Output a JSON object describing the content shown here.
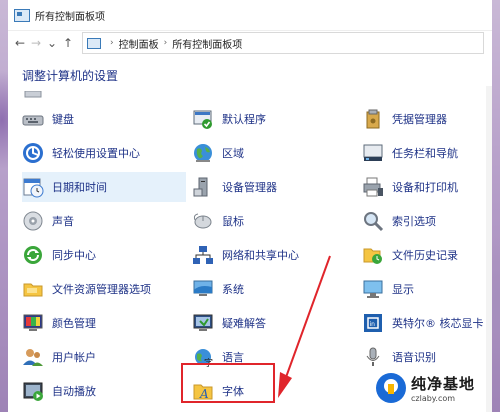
{
  "window": {
    "title": "所有控制面板项"
  },
  "nav": {
    "back": "←",
    "forward": "→",
    "recent": "⌄",
    "up": "↑",
    "breadcrumb": [
      "控制面板",
      "所有控制面板项"
    ],
    "separator": "›"
  },
  "heading": "调整计算机的设置",
  "items": [
    {
      "label": "键盘",
      "icon": "keyboard-icon"
    },
    {
      "label": "默认程序",
      "icon": "default-programs-icon"
    },
    {
      "label": "凭据管理器",
      "icon": "credential-manager-icon"
    },
    {
      "label": "轻松使用设置中心",
      "icon": "ease-of-access-icon"
    },
    {
      "label": "区域",
      "icon": "region-globe-icon"
    },
    {
      "label": "任务栏和导航",
      "icon": "taskbar-icon"
    },
    {
      "label": "日期和时间",
      "icon": "date-time-icon"
    },
    {
      "label": "设备管理器",
      "icon": "device-manager-icon"
    },
    {
      "label": "设备和打印机",
      "icon": "printer-icon"
    },
    {
      "label": "声音",
      "icon": "sound-icon"
    },
    {
      "label": "鼠标",
      "icon": "mouse-icon"
    },
    {
      "label": "索引选项",
      "icon": "indexing-icon"
    },
    {
      "label": "同步中心",
      "icon": "sync-icon"
    },
    {
      "label": "网络和共享中心",
      "icon": "network-icon"
    },
    {
      "label": "文件历史记录",
      "icon": "file-history-icon"
    },
    {
      "label": "文件资源管理器选项",
      "icon": "folder-options-icon"
    },
    {
      "label": "系统",
      "icon": "system-icon"
    },
    {
      "label": "显示",
      "icon": "display-icon"
    },
    {
      "label": "颜色管理",
      "icon": "color-management-icon"
    },
    {
      "label": "疑难解答",
      "icon": "troubleshooting-icon"
    },
    {
      "label": "英特尔® 核芯显卡",
      "icon": "intel-graphics-icon"
    },
    {
      "label": "用户帐户",
      "icon": "user-accounts-icon"
    },
    {
      "label": "语言",
      "icon": "language-icon"
    },
    {
      "label": "语音识别",
      "icon": "speech-microphone-icon"
    },
    {
      "label": "自动播放",
      "icon": "autoplay-icon"
    },
    {
      "label": "字体",
      "icon": "fonts-icon"
    }
  ],
  "selected_item": "日期和时间",
  "highlighted_item": "字体",
  "watermark": {
    "title": "纯净基地",
    "url": "czlaby.com"
  },
  "colors": {
    "link": "#1e3287",
    "highlight": "#e0252b",
    "selected_bg": "#e5f1fb"
  }
}
